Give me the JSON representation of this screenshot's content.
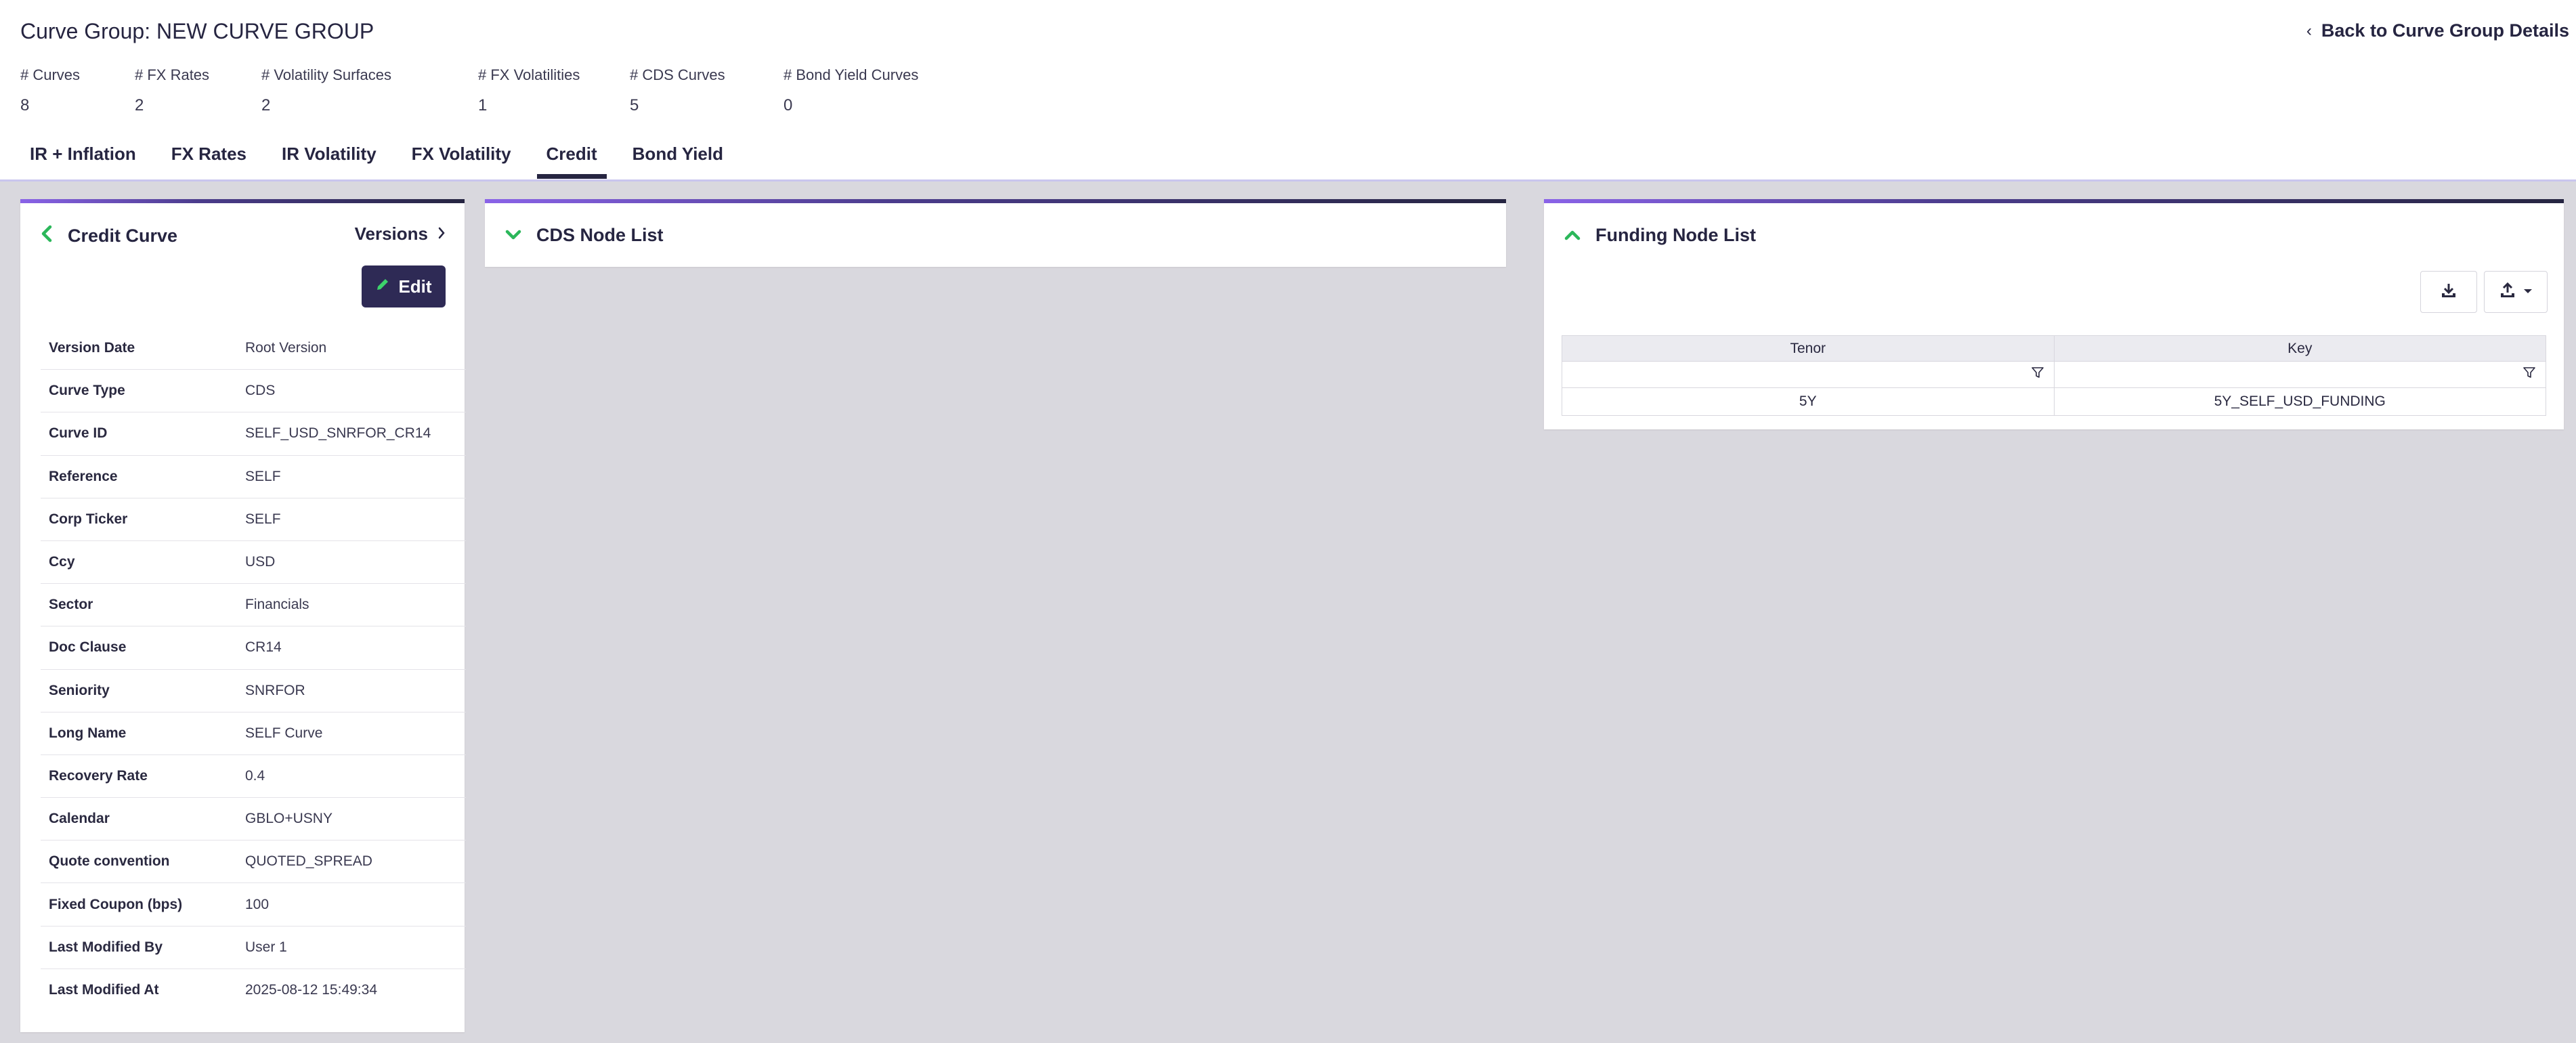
{
  "header": {
    "title": "Curve Group: NEW CURVE GROUP",
    "back_label": "Back to Curve Group Details",
    "stats": [
      {
        "label": "# Curves",
        "value": "8"
      },
      {
        "label": "# FX Rates",
        "value": "2"
      },
      {
        "label": "# Volatility Surfaces",
        "value": "2"
      },
      {
        "label": "# FX Volatilities",
        "value": "1"
      },
      {
        "label": "# CDS Curves",
        "value": "5"
      },
      {
        "label": "# Bond Yield Curves",
        "value": "0"
      }
    ],
    "tabs": [
      {
        "label": "IR + Inflation"
      },
      {
        "label": "FX Rates"
      },
      {
        "label": "IR Volatility"
      },
      {
        "label": "FX Volatility"
      },
      {
        "label": "Credit"
      },
      {
        "label": "Bond Yield"
      }
    ],
    "active_tab": "Credit"
  },
  "credit_curve": {
    "title": "Credit Curve",
    "versions_label": "Versions",
    "edit_label": "Edit",
    "details": [
      {
        "key": "Version Date",
        "value": "Root Version"
      },
      {
        "key": "Curve Type",
        "value": "CDS"
      },
      {
        "key": "Curve ID",
        "value": "SELF_USD_SNRFOR_CR14"
      },
      {
        "key": "Reference",
        "value": "SELF"
      },
      {
        "key": "Corp Ticker",
        "value": "SELF"
      },
      {
        "key": "Ccy",
        "value": "USD"
      },
      {
        "key": "Sector",
        "value": "Financials"
      },
      {
        "key": "Doc Clause",
        "value": "CR14"
      },
      {
        "key": "Seniority",
        "value": "SNRFOR"
      },
      {
        "key": "Long Name",
        "value": "SELF Curve"
      },
      {
        "key": "Recovery Rate",
        "value": "0.4"
      },
      {
        "key": "Calendar",
        "value": "GBLO+USNY"
      },
      {
        "key": "Quote convention",
        "value": "QUOTED_SPREAD"
      },
      {
        "key": "Fixed Coupon (bps)",
        "value": "100"
      },
      {
        "key": "Last Modified By",
        "value": "User 1"
      },
      {
        "key": "Last Modified At",
        "value": "2025-08-12 15:49:34"
      }
    ]
  },
  "cds_node_list": {
    "title": "CDS Node List"
  },
  "funding_node_list": {
    "title": "Funding Node List",
    "columns": [
      "Tenor",
      "Key"
    ],
    "rows": [
      {
        "tenor": "5Y",
        "key": "5Y_SELF_USD_FUNDING"
      }
    ]
  },
  "colors": {
    "accent": "#262541",
    "accent_gradient_start": "#8a63e8",
    "success_icon": "#2bb75a",
    "background": "#d9d8de"
  }
}
